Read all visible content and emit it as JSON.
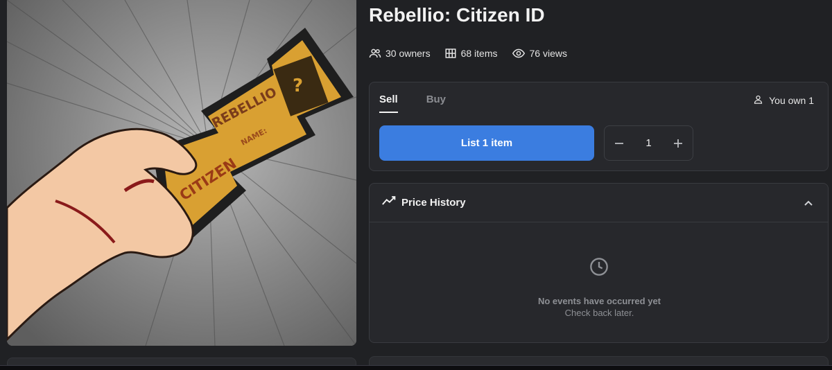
{
  "item": {
    "title": "Rebellio: Citizen ID"
  },
  "stats": {
    "owners": "30 owners",
    "items": "68 items",
    "views": "76 views"
  },
  "trade": {
    "tabs": [
      {
        "label": "Sell",
        "active": true
      },
      {
        "label": "Buy",
        "active": false
      }
    ],
    "ownership": "You own 1",
    "list_button": "List 1 item",
    "quantity": "1"
  },
  "price_history": {
    "title": "Price History",
    "empty_title": "No events have occurred yet",
    "empty_subtitle": "Check back later."
  },
  "artwork": {
    "card_brand": "REBELLIO",
    "card_name_label": "NAME:",
    "card_type": "CITIZEN",
    "card_photo_mark": "?"
  },
  "colors": {
    "accent": "#3b7de0",
    "background": "#202124",
    "panel": "#27282c",
    "card_gold": "#d9a032"
  },
  "icons": [
    "people-icon",
    "grid-icon",
    "eye-icon",
    "person-icon",
    "minus-icon",
    "plus-icon",
    "trend-icon",
    "chevron-up-icon",
    "clock-icon"
  ]
}
